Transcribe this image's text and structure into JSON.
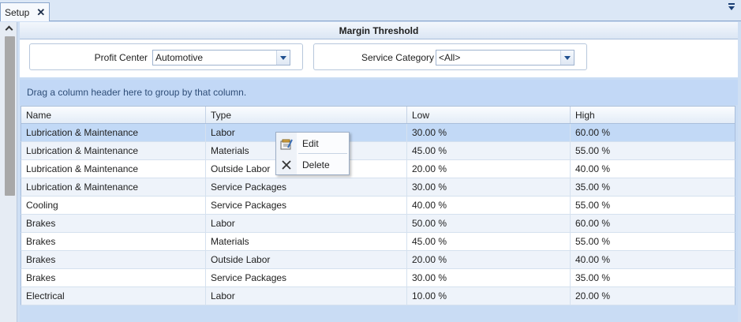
{
  "tab": {
    "label": "Setup",
    "close": "✕"
  },
  "section": {
    "title": "Margin Threshold"
  },
  "filters": {
    "profit_center": {
      "label": "Profit Center",
      "value": "Automotive"
    },
    "service_category": {
      "label": "Service Category",
      "value": "<All>"
    }
  },
  "group_panel": {
    "text": "Drag a column header here to group by that column."
  },
  "grid": {
    "columns": [
      "Name",
      "Type",
      "Low",
      "High"
    ],
    "rows": [
      [
        "Lubrication & Maintenance",
        "Labor",
        "30.00 %",
        "60.00 %"
      ],
      [
        "Lubrication & Maintenance",
        "Materials",
        "45.00 %",
        "55.00 %"
      ],
      [
        "Lubrication & Maintenance",
        "Outside Labor",
        "20.00 %",
        "40.00 %"
      ],
      [
        "Lubrication & Maintenance",
        "Service Packages",
        "30.00 %",
        "35.00 %"
      ],
      [
        "Cooling",
        "Service Packages",
        "40.00 %",
        "55.00 %"
      ],
      [
        "Brakes",
        "Labor",
        "50.00 %",
        "60.00 %"
      ],
      [
        "Brakes",
        "Materials",
        "45.00 %",
        "55.00 %"
      ],
      [
        "Brakes",
        "Outside Labor",
        "20.00 %",
        "40.00 %"
      ],
      [
        "Brakes",
        "Service Packages",
        "30.00 %",
        "35.00 %"
      ],
      [
        "Electrical",
        "Labor",
        "10.00 %",
        "20.00 %"
      ]
    ]
  },
  "context_menu": {
    "items": [
      {
        "label": "Edit",
        "icon": "edit-icon"
      },
      {
        "label": "Delete",
        "icon": "delete-icon"
      }
    ]
  },
  "colors": {
    "accent": "#1f4f8f",
    "selected_row": "#c2d9f6",
    "group_panel_text": "#2f4e78"
  }
}
